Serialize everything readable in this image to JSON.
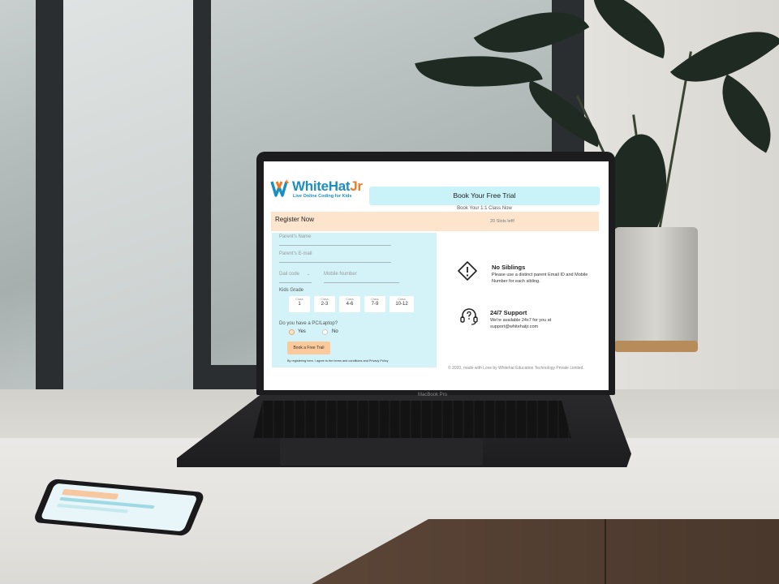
{
  "brand": {
    "name_main": "WhiteHat",
    "name_accent": "Jr",
    "tagline": "Live Online Coding for Kids",
    "color_blue": "#1b8fc0",
    "color_orange": "#f17a24"
  },
  "header": {
    "trial_title": "Book Your Free Trial",
    "trial_subtitle": "Book Your 1:1 Class Now"
  },
  "register": {
    "title": "Register Now",
    "slots": "20 Slots left!"
  },
  "form": {
    "parent_name_placeholder": "Parent's Name",
    "parent_email_placeholder": "Parent's E-mail",
    "dial_code_placeholder": "Dail code",
    "mobile_placeholder": "Mobile Number",
    "grade_label": "Kids Grade",
    "grades": [
      {
        "prefix": "Class",
        "value": "1"
      },
      {
        "prefix": "Class",
        "value": "2-3"
      },
      {
        "prefix": "Class",
        "value": "4-6"
      },
      {
        "prefix": "Class",
        "value": "7-9"
      },
      {
        "prefix": "Class",
        "value": "10-12"
      }
    ],
    "pc_question": "Do you have a PC/Laptop?",
    "pc_yes": "Yes",
    "pc_no": "No",
    "submit_label": "Book a Free Trail",
    "terms": "By registering here, I agree to the terms and conditions and Privacy Policy"
  },
  "info": {
    "siblings_title": "No Siblings",
    "siblings_body": "Please use a distinct parent Email ID and Mobile Number for each sibling.",
    "support_title": "24/7 Support",
    "support_body": "We're available 24x7 for you at support@whitehatjr.com"
  },
  "footer": {
    "copyright": "© 2020, made with Love by Whitehat Education Technology Private Limited."
  },
  "device": {
    "laptop_label": "MacBook Pro"
  },
  "icons": {
    "warning": "warning-diamond-icon",
    "support": "headset-question-icon",
    "dropdown": "chevron-down-icon"
  }
}
